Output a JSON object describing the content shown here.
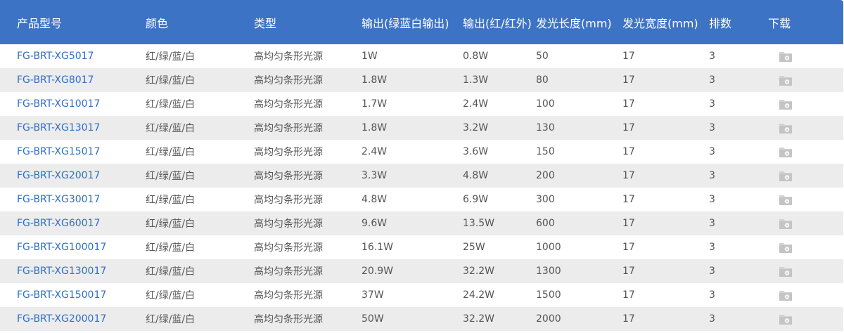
{
  "table": {
    "headers": [
      "产品型号",
      "颜色",
      "类型",
      "输出(绿蓝白输出)",
      "输出(红/红外)",
      "发光长度(mm)",
      "发光宽度(mm)",
      "排数",
      "下载"
    ],
    "rows": [
      {
        "model": "FG-BRT-XG5017",
        "color": "红/绿/蓝/白",
        "type": "高均匀条形光源",
        "out1": "1W",
        "out2": "0.8W",
        "length": "50",
        "width": "17",
        "rows": "3",
        "download_icon": "download-file-icon"
      },
      {
        "model": "FG-BRT-XG8017",
        "color": "红/绿/蓝/白",
        "type": "高均匀条形光源",
        "out1": "1.8W",
        "out2": "1.3W",
        "length": "80",
        "width": "17",
        "rows": "3",
        "download_icon": "download-file-icon"
      },
      {
        "model": "FG-BRT-XG10017",
        "color": "红/绿/蓝/白",
        "type": "高均匀条形光源",
        "out1": "1.7W",
        "out2": "2.4W",
        "length": "100",
        "width": "17",
        "rows": "3",
        "download_icon": "download-file-icon"
      },
      {
        "model": "FG-BRT-XG13017",
        "color": "红/绿/蓝/白",
        "type": "高均匀条形光源",
        "out1": "1.8W",
        "out2": "3.2W",
        "length": "130",
        "width": "17",
        "rows": "3",
        "download_icon": "download-file-icon"
      },
      {
        "model": "FG-BRT-XG15017",
        "color": "红/绿/蓝/白",
        "type": "高均匀条形光源",
        "out1": "2.4W",
        "out2": "3.6W",
        "length": "150",
        "width": "17",
        "rows": "3",
        "download_icon": "download-file-icon"
      },
      {
        "model": "FG-BRT-XG20017",
        "color": "红/绿/蓝/白",
        "type": "高均匀条形光源",
        "out1": "3.3W",
        "out2": "4.8W",
        "length": "200",
        "width": "17",
        "rows": "3",
        "download_icon": "download-file-icon"
      },
      {
        "model": "FG-BRT-XG30017",
        "color": "红/绿/蓝/白",
        "type": "高均匀条形光源",
        "out1": "4.8W",
        "out2": "6.9W",
        "length": "300",
        "width": "17",
        "rows": "3",
        "download_icon": "download-file-icon"
      },
      {
        "model": "FG-BRT-XG60017",
        "color": "红/绿/蓝/白",
        "type": "高均匀条形光源",
        "out1": "9.6W",
        "out2": "13.5W",
        "length": "600",
        "width": "17",
        "rows": "3",
        "download_icon": "download-file-icon"
      },
      {
        "model": "FG-BRT-XG100017",
        "color": "红/绿/蓝/白",
        "type": "高均匀条形光源",
        "out1": "16.1W",
        "out2": "25W",
        "length": "1000",
        "width": "17",
        "rows": "3",
        "download_icon": "download-file-icon"
      },
      {
        "model": "FG-BRT-XG130017",
        "color": "红/绿/蓝/白",
        "type": "高均匀条形光源",
        "out1": "20.9W",
        "out2": "32.2W",
        "length": "1300",
        "width": "17",
        "rows": "3",
        "download_icon": "download-file-icon"
      },
      {
        "model": "FG-BRT-XG150017",
        "color": "红/绿/蓝/白",
        "type": "高均匀条形光源",
        "out1": "37W",
        "out2": "24.2W",
        "length": "1500",
        "width": "17",
        "rows": "3",
        "download_icon": "download-file-icon"
      },
      {
        "model": "FG-BRT-XG200017",
        "color": "红/绿/蓝/白",
        "type": "高均匀条形光源",
        "out1": "50W",
        "out2": "32.2W",
        "length": "2000",
        "width": "17",
        "rows": "3",
        "download_icon": "download-file-icon"
      }
    ]
  },
  "colors": {
    "header_bg": "#3d73c4",
    "header_text": "#ffffff",
    "link": "#2f6fc6",
    "text": "#555555",
    "stripe": "#ececec",
    "icon": "#c8c8c8"
  }
}
